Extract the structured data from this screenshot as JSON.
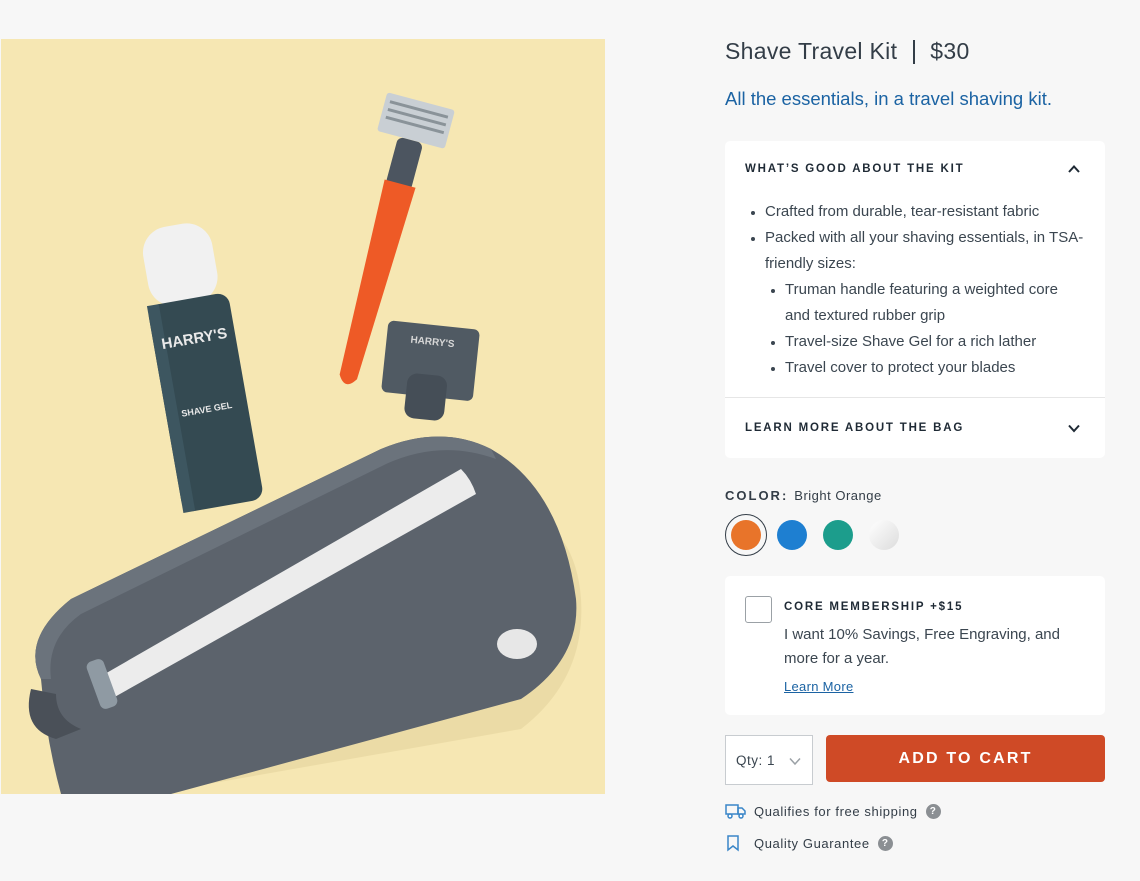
{
  "product": {
    "title": "Shave Travel Kit",
    "price": "$30",
    "tagline": "All the essentials, in a travel shaving kit.",
    "image_brand_gel": "HARRY'S",
    "image_gel_text": "SHAVE GEL",
    "image_brand_cover": "HARRY'S"
  },
  "accordion": {
    "kit_header": "WHAT’S GOOD ABOUT THE KIT",
    "kit_items": [
      "Crafted from durable, tear-resistant fabric",
      "Packed with all your shaving essentials, in TSA-friendly sizes:"
    ],
    "kit_subitems": [
      "Truman handle featuring a weighted core and textured rubber grip",
      "Travel-size Shave Gel for a rich lather",
      "Travel cover to protect your blades"
    ],
    "bag_header": "LEARN MORE ABOUT THE BAG"
  },
  "color": {
    "label": "COLOR:",
    "selected": "Bright Orange",
    "swatches": [
      {
        "name": "orange",
        "hex": "#e8742a"
      },
      {
        "name": "blue",
        "hex": "#1e7fd1"
      },
      {
        "name": "teal",
        "hex": "#1c9d8c"
      },
      {
        "name": "white",
        "hex": "#e8e8e8"
      }
    ]
  },
  "membership": {
    "title": "CORE MEMBERSHIP +$15",
    "description": "I want 10% Savings, Free Engraving, and more for a year.",
    "link": "Learn More"
  },
  "purchase": {
    "qty_label": "Qty: 1",
    "add_to_cart": "ADD TO CART"
  },
  "perks": {
    "shipping": "Qualifies for free shipping",
    "guarantee": "Quality Guarantee",
    "help_glyph": "?"
  },
  "colors": {
    "accent_blue": "#1b63a3",
    "cta": "#cf4a26",
    "text": "#333d47"
  }
}
